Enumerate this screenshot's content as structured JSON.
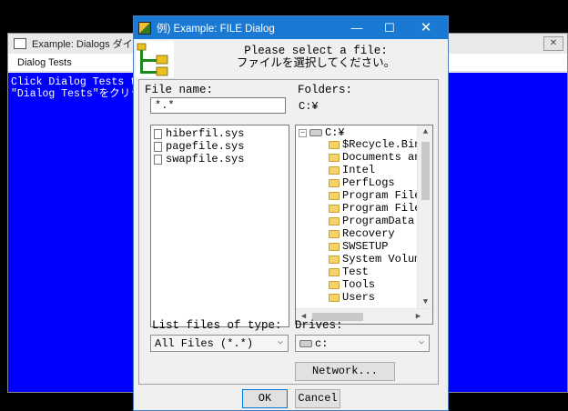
{
  "background_window": {
    "title": "Example: Dialogs  ダイア",
    "menu": "Dialog Tests",
    "client_text": "Click Dialog Tests to\n\"Dialog Tests\"をクリッ",
    "client_color": "#0000ff"
  },
  "dialog": {
    "title": "例) Example: FILE Dialog",
    "titlebar_color": "#1979d3",
    "prompt_line1": "Please select a file:",
    "prompt_line2": "ファイルを選択してください。",
    "file_name_label": "File name:",
    "file_name_value": "*.*",
    "folders_label": "Folders:",
    "current_path": "C:¥",
    "files": [
      "hiberfil.sys",
      "pagefile.sys",
      "swapfile.sys"
    ],
    "tree_root": "C:¥",
    "folders": [
      "$Recycle.Bin",
      "Documents and",
      "Intel",
      "PerfLogs",
      "Program Files",
      "Program Files",
      "ProgramData",
      "Recovery",
      "SWSETUP",
      "System Volume",
      "Test",
      "Tools",
      "Users"
    ],
    "list_type_label": "List files of type:",
    "list_type_value": "All Files (*.*)",
    "drives_label": "Drives:",
    "drives_value": "c:",
    "network_button": "Network...",
    "ok_button": "OK",
    "cancel_button": "Cancel"
  }
}
